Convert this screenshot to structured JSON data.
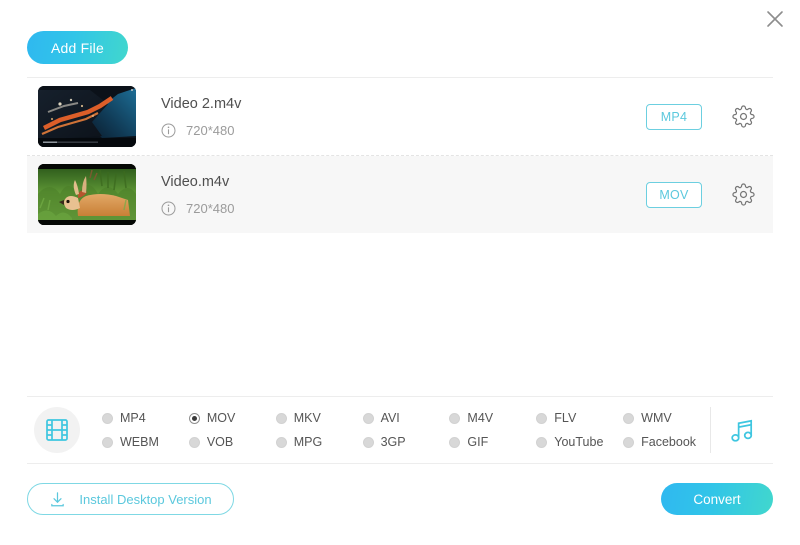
{
  "window": {
    "close_label": "×"
  },
  "toolbar": {
    "add_file_label": "Add File"
  },
  "files": [
    {
      "name": "Video 2.m4v",
      "resolution": "720*480",
      "output_format": "MP4",
      "thumbnail": "aerial-coastline-night",
      "selected": false
    },
    {
      "name": "Video.m4v",
      "resolution": "720*480",
      "output_format": "MOV",
      "thumbnail": "deer-in-grass",
      "selected": true
    }
  ],
  "format_panel": {
    "video_icon": "film-strip-icon",
    "audio_icon": "music-note-icon",
    "selected_format": "MOV",
    "formats": [
      "MP4",
      "MOV",
      "MKV",
      "AVI",
      "M4V",
      "FLV",
      "WMV",
      "WEBM",
      "VOB",
      "MPG",
      "3GP",
      "GIF",
      "YouTube",
      "Facebook"
    ]
  },
  "footer": {
    "install_label": "Install Desktop Version",
    "install_icon": "download-icon",
    "convert_label": "Convert"
  },
  "colors": {
    "accent": "#5bc8dd",
    "gradient_start": "#2fb8f0",
    "gradient_end": "#41d7cd",
    "row_active_bg": "#f7f7f7",
    "text_primary": "#4f4f4f",
    "text_muted": "#9b9b9b"
  }
}
